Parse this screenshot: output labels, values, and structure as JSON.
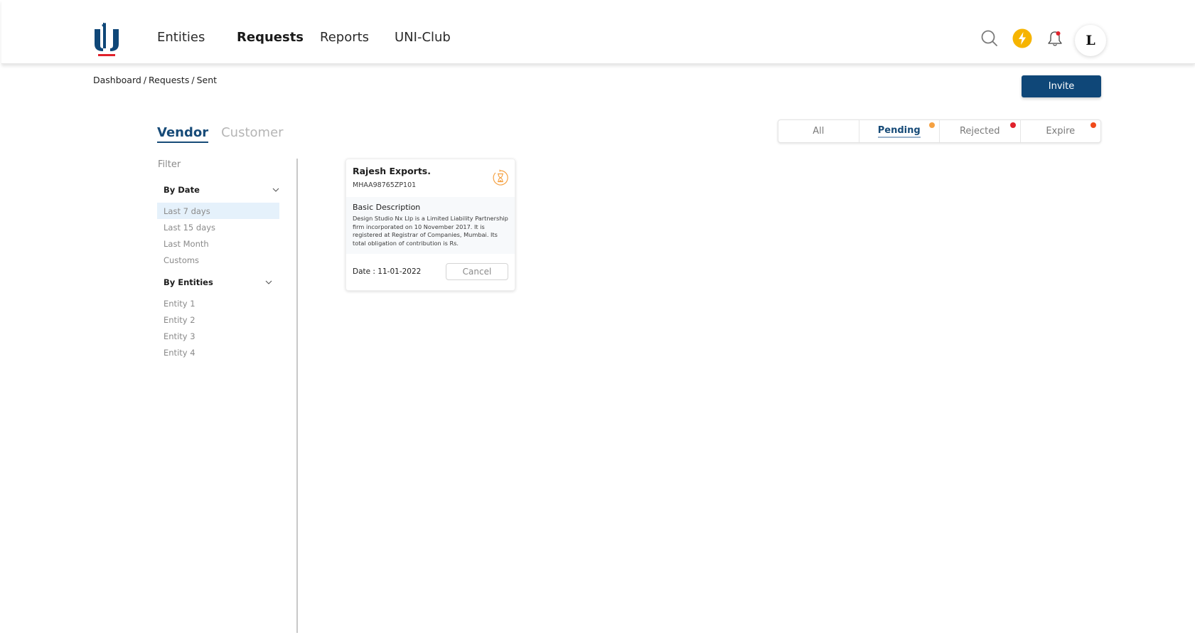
{
  "header": {
    "logo": "uni-logo",
    "nav": [
      {
        "label": "Entities",
        "active": false
      },
      {
        "label": "Requests",
        "active": true
      },
      {
        "label": "Reports",
        "active": false
      },
      {
        "label": "UNI-Club",
        "active": false
      }
    ],
    "icons": [
      "search-icon",
      "lightning-icon",
      "bell-icon"
    ],
    "notification_dot_color": "#e0212b",
    "lightning_color": "#f6b400",
    "avatar_initial": "L"
  },
  "breadcrumb": [
    "Dashboard",
    "/",
    "Requests",
    "/",
    "Sent"
  ],
  "actions": {
    "invite_label": "Invite",
    "brand_color": "#0f4778"
  },
  "party_tabs": [
    {
      "label": "Vendor",
      "active": true
    },
    {
      "label": "Customer",
      "active": false
    }
  ],
  "status_tabs": [
    {
      "label": "All",
      "active": false,
      "dot": null
    },
    {
      "label": "Pending",
      "active": true,
      "dot": "#f5a142"
    },
    {
      "label": "Rejected",
      "active": false,
      "dot": "#e0212b"
    },
    {
      "label": "Expire",
      "active": false,
      "dot": "#f04a1a"
    }
  ],
  "filter": {
    "title": "Filter",
    "groups": [
      {
        "label": "By Date",
        "items": [
          {
            "label": "Last 7 days",
            "selected": true
          },
          {
            "label": "Last 15 days",
            "selected": false
          },
          {
            "label": "Last Month",
            "selected": false
          },
          {
            "label": "Customs",
            "selected": false
          }
        ]
      },
      {
        "label": "By Entities",
        "items": [
          {
            "label": "Entity 1",
            "selected": false
          },
          {
            "label": "Entity 2",
            "selected": false
          },
          {
            "label": "Entity 3",
            "selected": false
          },
          {
            "label": "Entity 4",
            "selected": false
          }
        ]
      }
    ]
  },
  "requests": [
    {
      "name": "Rajesh Exports.",
      "id": "MHAA98765ZP101",
      "status_icon": "hourglass-pending-icon",
      "status_color": "#f5a142",
      "description_title": "Basic Description",
      "description": "Design Studio Nx Llp is a Limited Liability Partnership firm incorporated on 10 November 2017. It is registered at Registrar of Companies, Mumbai. Its total obligation of contribution is Rs.",
      "date_label": "Date : 11-01-2022",
      "cancel_label": "Cancel"
    }
  ]
}
